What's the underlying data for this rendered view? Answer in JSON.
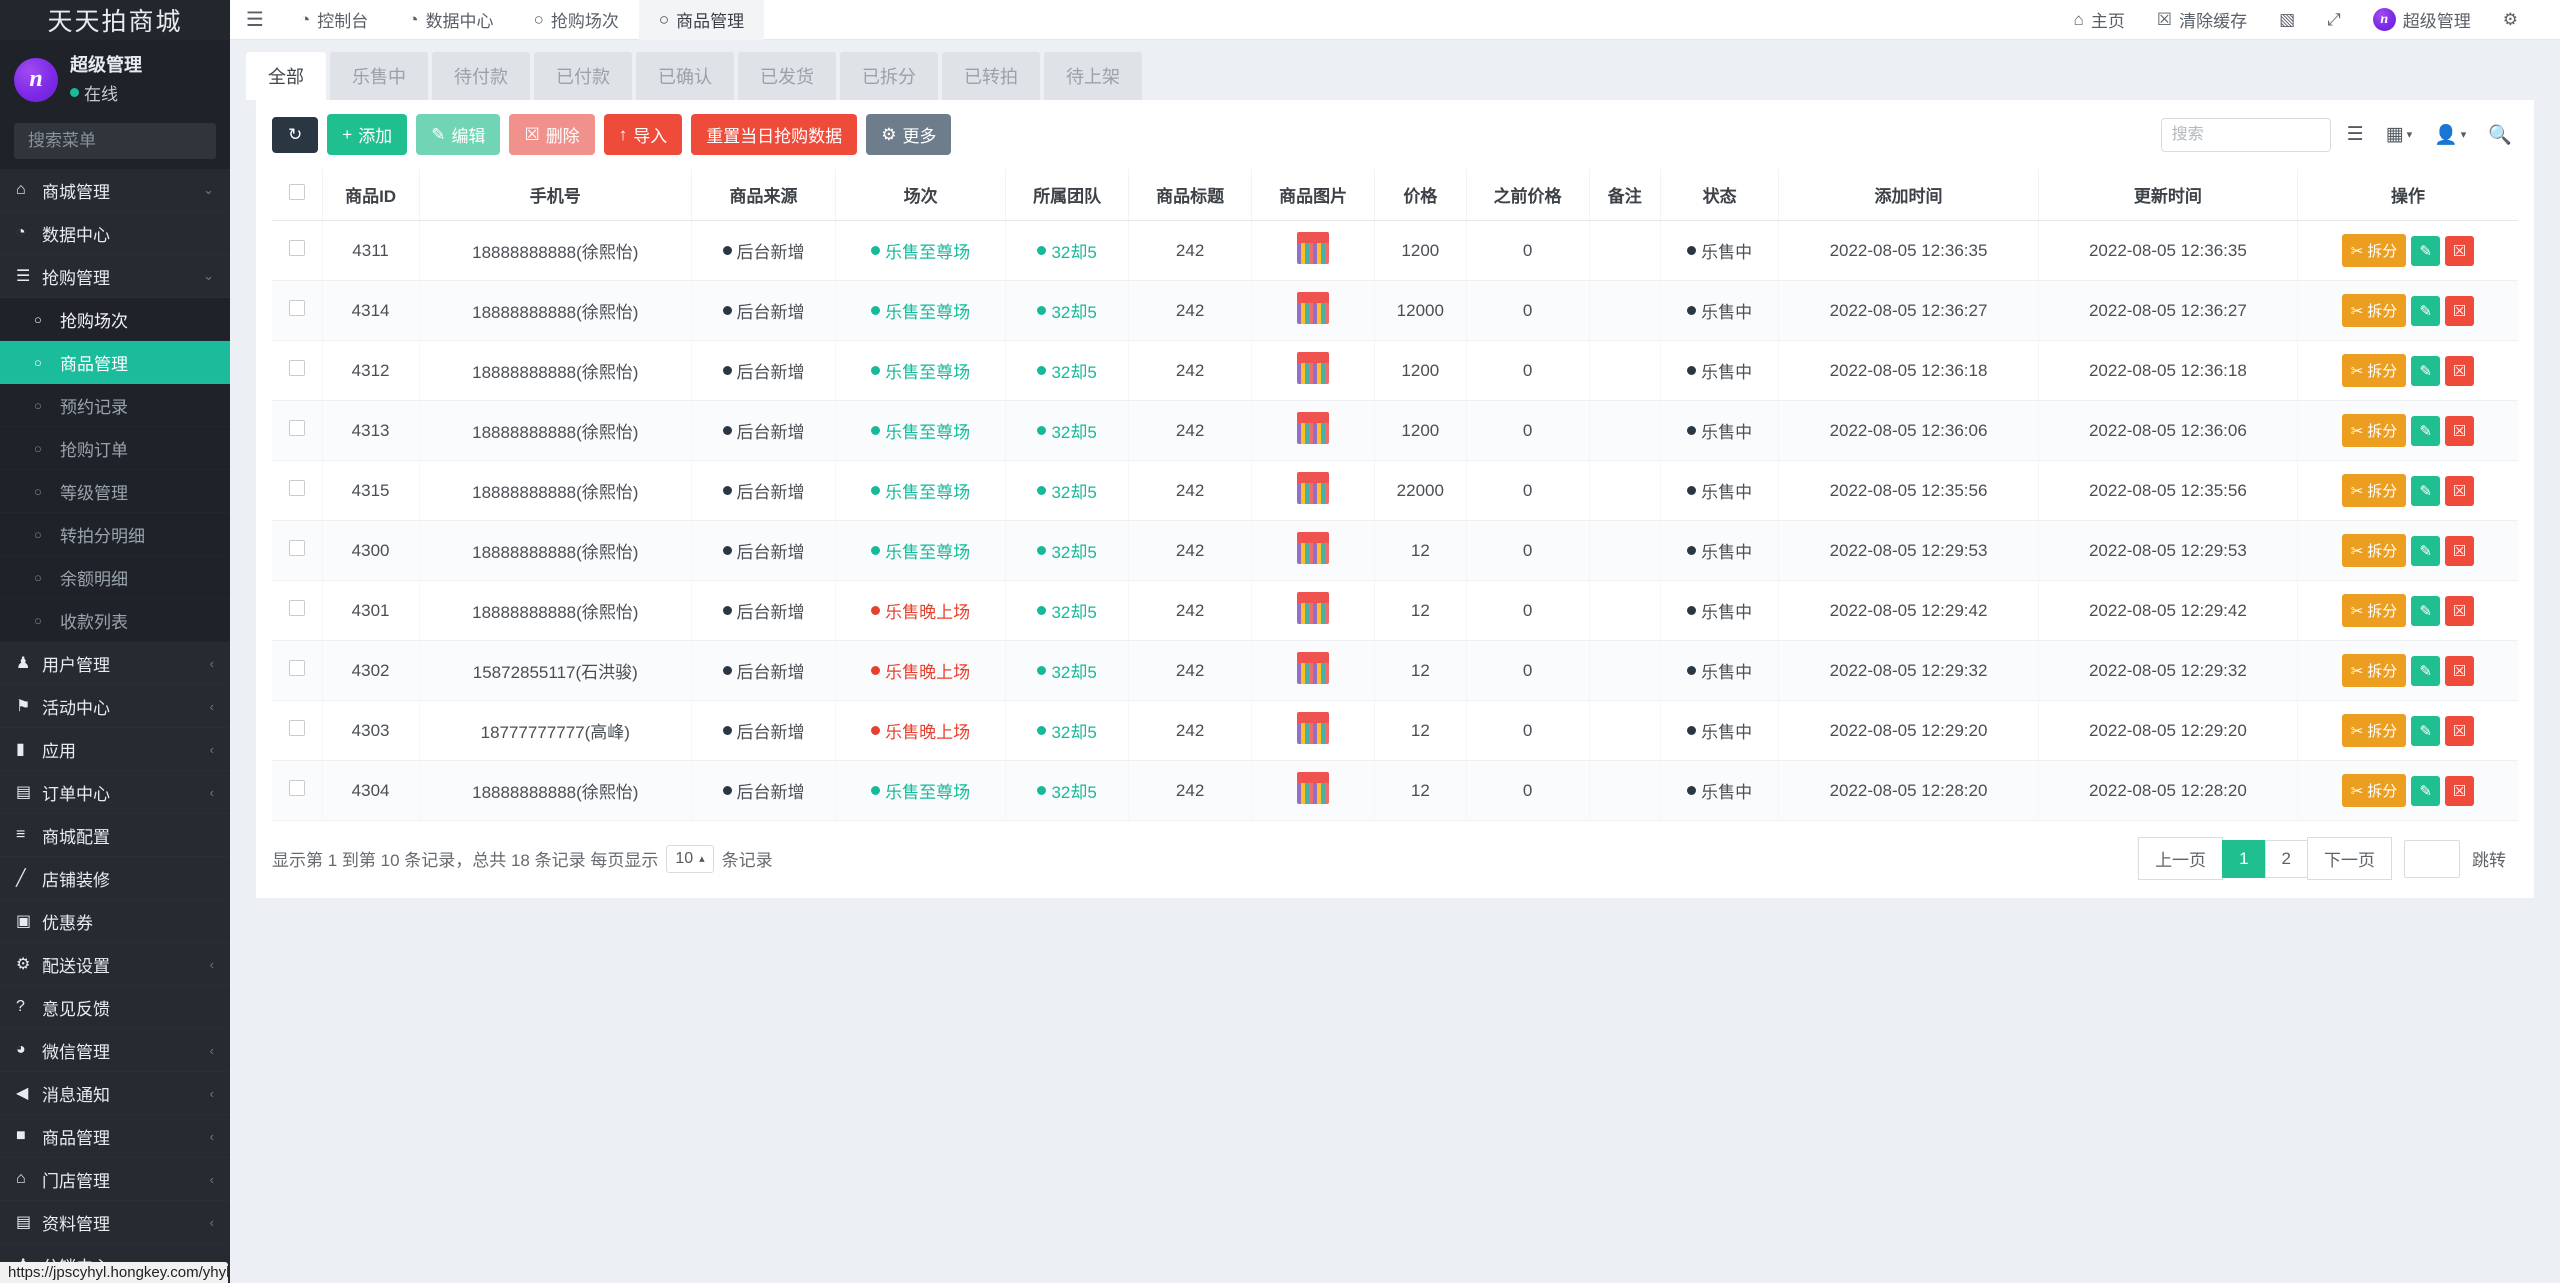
{
  "sidebar": {
    "brand": "天天拍商城",
    "user": {
      "name": "超级管理",
      "status": "在线",
      "avatar_letter": "n"
    },
    "search_placeholder": "搜索菜单",
    "items": [
      {
        "label": "商城管理",
        "icon": "home-icon",
        "caret": "⌄",
        "level": "top",
        "active": false
      },
      {
        "label": "数据中心",
        "icon": "dashboard-icon",
        "caret": "",
        "level": "top",
        "active": false
      },
      {
        "label": "抢购管理",
        "icon": "list-icon",
        "caret": "⌄",
        "level": "top",
        "active": false
      },
      {
        "label": "抢购场次",
        "icon": "circle-icon",
        "caret": "",
        "level": "sub-white",
        "active": false
      },
      {
        "label": "商品管理",
        "icon": "circle-icon",
        "caret": "",
        "level": "sub",
        "active": true
      },
      {
        "label": "预约记录",
        "icon": "circle-icon",
        "caret": "",
        "level": "sub",
        "active": false
      },
      {
        "label": "抢购订单",
        "icon": "circle-icon",
        "caret": "",
        "level": "sub",
        "active": false
      },
      {
        "label": "等级管理",
        "icon": "circle-icon",
        "caret": "",
        "level": "sub",
        "active": false
      },
      {
        "label": "转拍分明细",
        "icon": "circle-icon",
        "caret": "",
        "level": "sub",
        "active": false
      },
      {
        "label": "余额明细",
        "icon": "circle-icon",
        "caret": "",
        "level": "sub",
        "active": false
      },
      {
        "label": "收款列表",
        "icon": "circle-icon",
        "caret": "",
        "level": "sub",
        "active": false
      },
      {
        "label": "用户管理",
        "icon": "user-icon",
        "caret": "‹",
        "level": "top",
        "active": false
      },
      {
        "label": "活动中心",
        "icon": "flag-icon",
        "caret": "‹",
        "level": "top",
        "active": false
      },
      {
        "label": "应用",
        "icon": "briefcase-icon",
        "caret": "‹",
        "level": "top",
        "active": false
      },
      {
        "label": "订单中心",
        "icon": "file-icon",
        "caret": "‹",
        "level": "top",
        "active": false
      },
      {
        "label": "商城配置",
        "icon": "sliders-icon",
        "caret": "",
        "level": "top",
        "active": false
      },
      {
        "label": "店铺装修",
        "icon": "brush-icon",
        "caret": "",
        "level": "top",
        "active": false
      },
      {
        "label": "优惠券",
        "icon": "ticket-icon",
        "caret": "",
        "level": "top",
        "active": false
      },
      {
        "label": "配送设置",
        "icon": "gears-icon",
        "caret": "‹",
        "level": "top",
        "active": false
      },
      {
        "label": "意见反馈",
        "icon": "question-icon",
        "caret": "",
        "level": "top",
        "active": false
      },
      {
        "label": "微信管理",
        "icon": "wechat-icon",
        "caret": "‹",
        "level": "top",
        "active": false
      },
      {
        "label": "消息通知",
        "icon": "megaphone-icon",
        "caret": "‹",
        "level": "top",
        "active": false
      },
      {
        "label": "商品管理",
        "icon": "box-icon",
        "caret": "‹",
        "level": "top",
        "active": false
      },
      {
        "label": "门店管理",
        "icon": "bank-icon",
        "caret": "‹",
        "level": "top",
        "active": false
      },
      {
        "label": "资料管理",
        "icon": "doc-icon",
        "caret": "‹",
        "level": "top",
        "active": false
      },
      {
        "label": "分销中心",
        "icon": "users-icon",
        "caret": "‹",
        "level": "top",
        "active": false
      }
    ],
    "status_url": "https://jpscyhyl.hongkey.com/yhyladmin.php/rush/rush_config?ref=addtabs"
  },
  "topbar": {
    "menu_icon": "hamburger-icon",
    "nav": [
      {
        "label": "控制台",
        "icon": "dashboard-icon",
        "selected": false
      },
      {
        "label": "数据中心",
        "icon": "dashboard-icon",
        "selected": false
      },
      {
        "label": "抢购场次",
        "icon": "circle-icon",
        "selected": false
      },
      {
        "label": "商品管理",
        "icon": "circle-icon",
        "selected": true
      }
    ],
    "right": [
      {
        "label": "主页",
        "icon": "home-icon"
      },
      {
        "label": "清除缓存",
        "icon": "trash-icon"
      },
      {
        "label": "",
        "icon": "window-icon"
      },
      {
        "label": "",
        "icon": "fullscreen-icon"
      },
      {
        "label": "超级管理",
        "icon": "avatar-icon"
      },
      {
        "label": "",
        "icon": "gears-icon"
      }
    ]
  },
  "tabs": [
    {
      "label": "全部",
      "selected": true
    },
    {
      "label": "乐售中",
      "selected": false
    },
    {
      "label": "待付款",
      "selected": false
    },
    {
      "label": "已付款",
      "selected": false
    },
    {
      "label": "已确认",
      "selected": false
    },
    {
      "label": "已发货",
      "selected": false
    },
    {
      "label": "已拆分",
      "selected": false
    },
    {
      "label": "已转拍",
      "selected": false
    },
    {
      "label": "待上架",
      "selected": false
    }
  ],
  "toolbar": {
    "refresh_label": "",
    "refresh_icon": "refresh-icon",
    "buttons": [
      {
        "label": "添加",
        "icon": "plus-icon",
        "style": "btn-green"
      },
      {
        "label": "编辑",
        "icon": "pencil-icon",
        "style": "btn-green2"
      },
      {
        "label": "删除",
        "icon": "trash-icon",
        "style": "btn-rose"
      },
      {
        "label": "导入",
        "icon": "upload-icon",
        "style": "btn-red"
      },
      {
        "label": "重置当日抢购数据",
        "icon": "",
        "style": "btn-red2"
      },
      {
        "label": "更多",
        "icon": "gear-icon",
        "style": "btn-grey"
      }
    ],
    "search_placeholder": "搜索",
    "icons": [
      {
        "name": "list-view-icon"
      },
      {
        "name": "grid-view-icon"
      },
      {
        "name": "user-filter-icon"
      },
      {
        "name": "search-icon"
      }
    ]
  },
  "table": {
    "columns": [
      "商品ID",
      "手机号",
      "商品来源",
      "场次",
      "所属团队",
      "商品标题",
      "商品图片",
      "价格",
      "之前价格",
      "备注",
      "状态",
      "添加时间",
      "更新时间",
      "操作"
    ],
    "rows": [
      {
        "id": "4311",
        "phone": "18888888888(徐熙怡)",
        "source": "后台新增",
        "session": "乐售至尊场",
        "session_color": "green",
        "team": "32却5",
        "title": "242",
        "price": "1200",
        "prev_price": "0",
        "note": "",
        "status": "乐售中",
        "added": "2022-08-05 12:36:35",
        "updated": "2022-08-05 12:36:35"
      },
      {
        "id": "4314",
        "phone": "18888888888(徐熙怡)",
        "source": "后台新增",
        "session": "乐售至尊场",
        "session_color": "green",
        "team": "32却5",
        "title": "242",
        "price": "12000",
        "prev_price": "0",
        "note": "",
        "status": "乐售中",
        "added": "2022-08-05 12:36:27",
        "updated": "2022-08-05 12:36:27"
      },
      {
        "id": "4312",
        "phone": "18888888888(徐熙怡)",
        "source": "后台新增",
        "session": "乐售至尊场",
        "session_color": "green",
        "team": "32却5",
        "title": "242",
        "price": "1200",
        "prev_price": "0",
        "note": "",
        "status": "乐售中",
        "added": "2022-08-05 12:36:18",
        "updated": "2022-08-05 12:36:18"
      },
      {
        "id": "4313",
        "phone": "18888888888(徐熙怡)",
        "source": "后台新增",
        "session": "乐售至尊场",
        "session_color": "green",
        "team": "32却5",
        "title": "242",
        "price": "1200",
        "prev_price": "0",
        "note": "",
        "status": "乐售中",
        "added": "2022-08-05 12:36:06",
        "updated": "2022-08-05 12:36:06"
      },
      {
        "id": "4315",
        "phone": "18888888888(徐熙怡)",
        "source": "后台新增",
        "session": "乐售至尊场",
        "session_color": "green",
        "team": "32却5",
        "title": "242",
        "price": "22000",
        "prev_price": "0",
        "note": "",
        "status": "乐售中",
        "added": "2022-08-05 12:35:56",
        "updated": "2022-08-05 12:35:56"
      },
      {
        "id": "4300",
        "phone": "18888888888(徐熙怡)",
        "source": "后台新增",
        "session": "乐售至尊场",
        "session_color": "green",
        "team": "32却5",
        "title": "242",
        "price": "12",
        "prev_price": "0",
        "note": "",
        "status": "乐售中",
        "added": "2022-08-05 12:29:53",
        "updated": "2022-08-05 12:29:53"
      },
      {
        "id": "4301",
        "phone": "18888888888(徐熙怡)",
        "source": "后台新增",
        "session": "乐售晚上场",
        "session_color": "red",
        "team": "32却5",
        "title": "242",
        "price": "12",
        "prev_price": "0",
        "note": "",
        "status": "乐售中",
        "added": "2022-08-05 12:29:42",
        "updated": "2022-08-05 12:29:42"
      },
      {
        "id": "4302",
        "phone": "15872855117(石洪骏)",
        "source": "后台新增",
        "session": "乐售晚上场",
        "session_color": "red",
        "team": "32却5",
        "title": "242",
        "price": "12",
        "prev_price": "0",
        "note": "",
        "status": "乐售中",
        "added": "2022-08-05 12:29:32",
        "updated": "2022-08-05 12:29:32"
      },
      {
        "id": "4303",
        "phone": "18777777777(高峰)",
        "source": "后台新增",
        "session": "乐售晚上场",
        "session_color": "red",
        "team": "32却5",
        "title": "242",
        "price": "12",
        "prev_price": "0",
        "note": "",
        "status": "乐售中",
        "added": "2022-08-05 12:29:20",
        "updated": "2022-08-05 12:29:20"
      },
      {
        "id": "4304",
        "phone": "18888888888(徐熙怡)",
        "source": "后台新增",
        "session": "乐售至尊场",
        "session_color": "green",
        "team": "32却5",
        "title": "242",
        "price": "12",
        "prev_price": "0",
        "note": "",
        "status": "乐售中",
        "added": "2022-08-05 12:28:20",
        "updated": "2022-08-05 12:28:20"
      }
    ],
    "row_actions": [
      {
        "label": "拆分",
        "icon": "split-icon",
        "style": "a-orange"
      },
      {
        "label": "",
        "icon": "pencil-icon",
        "style": "a-teal"
      },
      {
        "label": "",
        "icon": "trash-icon",
        "style": "a-red"
      }
    ]
  },
  "footer": {
    "info": "显示第 1 到第 10 条记录，总共 18 条记录 每页显示",
    "page_size": "10",
    "info_suffix": "条记录",
    "pager": {
      "prev": "上一页",
      "pages": [
        "1",
        "2"
      ],
      "current": "1",
      "next": "下一页",
      "jump_value": "",
      "jump_label": "跳转"
    }
  },
  "colors": {
    "accent": "#1fbf8f",
    "danger": "#ee4b3a",
    "sidebar": "#1f2329",
    "orange": "#ec9e20"
  }
}
